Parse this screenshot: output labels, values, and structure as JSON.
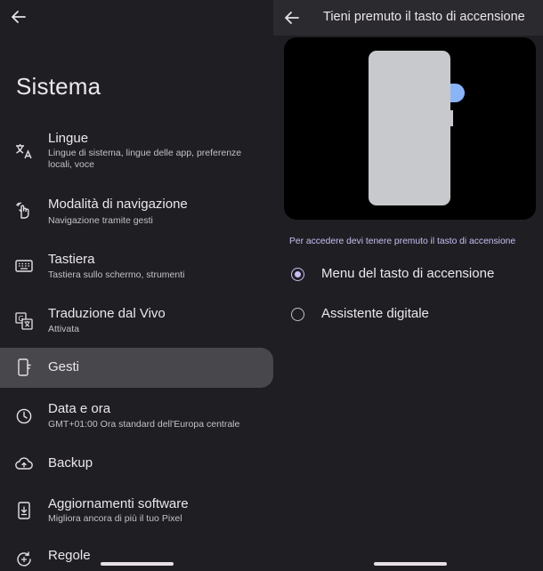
{
  "left": {
    "title": "Sistema",
    "items": [
      {
        "icon": "translate-icon",
        "title": "Lingue",
        "subtitle": "Lingue di sistema, lingue delle app, preferenze locali, voce"
      },
      {
        "icon": "gesture-hand-icon",
        "title": "Modalità di navigazione",
        "subtitle": "Navigazione tramite gesti"
      },
      {
        "icon": "keyboard-icon",
        "title": "Tastiera",
        "subtitle": "Tastiera sullo schermo, strumenti"
      },
      {
        "icon": "live-translate-icon",
        "title": "Traduzione dal Vivo",
        "subtitle": "Attivata"
      },
      {
        "icon": "gesture-phone-icon",
        "title": "Gesti",
        "subtitle": ""
      },
      {
        "icon": "clock-icon",
        "title": "Data e ora",
        "subtitle": "GMT+01:00 Ora standard dell'Europa centrale"
      },
      {
        "icon": "cloud-upload-icon",
        "title": "Backup",
        "subtitle": ""
      },
      {
        "icon": "system-update-icon",
        "title": "Aggiornamenti software",
        "subtitle": "Migliora ancora di più il tuo Pixel"
      },
      {
        "icon": "rules-icon",
        "title": "Regole",
        "subtitle": ""
      }
    ],
    "selected_item": "Gesti"
  },
  "right": {
    "header_title": "Tieni premuto il tasto di accensione",
    "hint": "Per accedere devi tenere premuto il tasto di accensione",
    "options": [
      {
        "label": "Menu del tasto di accensione",
        "selected": true
      },
      {
        "label": "Assistente digitale",
        "selected": false
      }
    ]
  },
  "colors": {
    "background": "#1f1f23",
    "header_background": "#2b2a2f",
    "selected_item_background": "#48474c",
    "accent": "#c9bdf2",
    "press_indicator": "#8ab4f8",
    "phone_body": "#c7c9cc"
  }
}
